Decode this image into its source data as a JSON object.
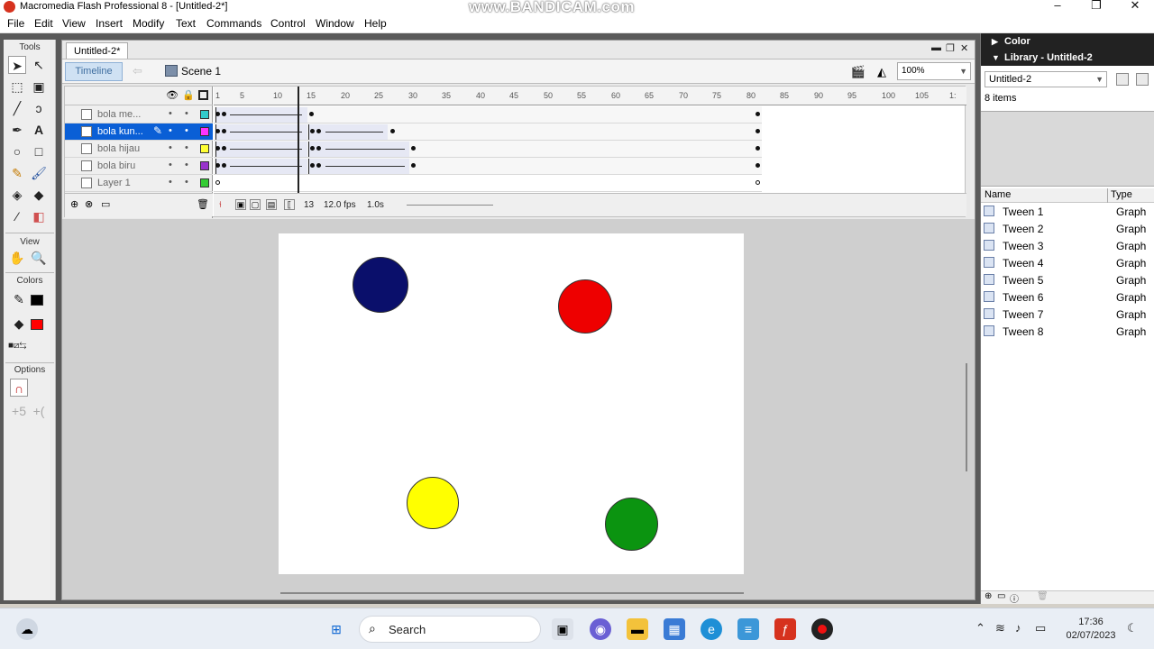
{
  "app": {
    "title": "Macromedia Flash Professional 8 - [Untitled-2*]",
    "watermark": "www.BANDICAM.com",
    "window_controls": [
      "–",
      "❐",
      "✕"
    ]
  },
  "menu": [
    "File",
    "Edit",
    "View",
    "Insert",
    "Modify",
    "Text",
    "Commands",
    "Control",
    "Window",
    "Help"
  ],
  "tools_panel": {
    "tools_header": "Tools",
    "view_header": "View",
    "colors_header": "Colors",
    "options_header": "Options",
    "stroke_color": "#000000",
    "fill_color": "#ff0000"
  },
  "document": {
    "tab_label": "Untitled-2*",
    "timeline_button": "Timeline",
    "scene_label": "Scene 1",
    "zoom_value": "100%"
  },
  "timeline": {
    "ruler_ticks": [
      "1",
      "5",
      "10",
      "15",
      "20",
      "25",
      "30",
      "35",
      "40",
      "45",
      "50",
      "55",
      "60",
      "65",
      "70",
      "75",
      "80",
      "85",
      "90",
      "95",
      "100",
      "105",
      "1:"
    ],
    "layers": [
      {
        "name": "bola me...",
        "outline_color": "#33cccc",
        "selected": false
      },
      {
        "name": "bola kun...",
        "outline_color": "#ff33ff",
        "selected": true
      },
      {
        "name": "bola hijau",
        "outline_color": "#ffff33",
        "selected": false
      },
      {
        "name": "bola biru",
        "outline_color": "#9933cc",
        "selected": false
      },
      {
        "name": "Layer 1",
        "outline_color": "#33cc33",
        "selected": false
      }
    ],
    "current_frame": "13",
    "frame_rate": "12.0 fps",
    "elapsed": "1.0s"
  },
  "stage": {
    "balls": [
      {
        "color": "#0a0f6b",
        "name": "blue"
      },
      {
        "color": "#ee0000",
        "name": "red"
      },
      {
        "color": "#ffff00",
        "name": "yellow"
      },
      {
        "color": "#0b9410",
        "name": "green"
      }
    ]
  },
  "panels": {
    "color_panel_title": "Color",
    "library_title": "Library - Untitled-2",
    "library_select": "Untitled-2",
    "items_count": "8 items",
    "columns": {
      "name": "Name",
      "type": "Type"
    },
    "items": [
      {
        "name": "Tween 1",
        "type": "Graph"
      },
      {
        "name": "Tween 2",
        "type": "Graph"
      },
      {
        "name": "Tween 3",
        "type": "Graph"
      },
      {
        "name": "Tween 4",
        "type": "Graph"
      },
      {
        "name": "Tween 5",
        "type": "Graph"
      },
      {
        "name": "Tween 6",
        "type": "Graph"
      },
      {
        "name": "Tween 7",
        "type": "Graph"
      },
      {
        "name": "Tween 8",
        "type": "Graph"
      }
    ]
  },
  "taskbar": {
    "search_label": "Search",
    "time": "17:36",
    "date": "02/07/2023"
  }
}
